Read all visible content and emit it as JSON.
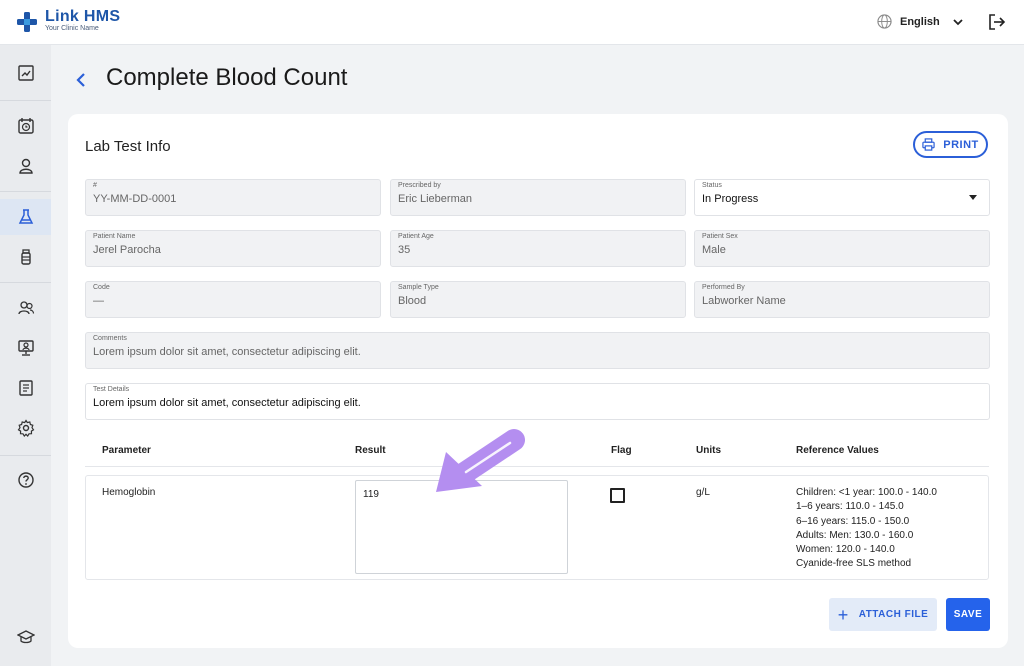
{
  "app": {
    "name": "Link HMS",
    "subtitle": "Your Clinic Name"
  },
  "header": {
    "language": "English"
  },
  "page": {
    "title": "Complete Blood Count"
  },
  "card": {
    "title": "Lab Test Info",
    "print_label": "PRINT"
  },
  "fields": {
    "id": {
      "label": "#",
      "value": "YY-MM-DD-0001"
    },
    "prescribed_by": {
      "label": "Prescribed by",
      "value": "Eric Lieberman"
    },
    "status": {
      "label": "Status",
      "value": "In Progress"
    },
    "patient_name": {
      "label": "Patient Name",
      "value": "Jerel Parocha"
    },
    "patient_age": {
      "label": "Patient Age",
      "value": "35"
    },
    "patient_sex": {
      "label": "Patient Sex",
      "value": "Male"
    },
    "code": {
      "label": "Code",
      "value": "—"
    },
    "sample_type": {
      "label": "Sample Type",
      "value": "Blood"
    },
    "performed_by": {
      "label": "Performed By",
      "value": "Labworker Name"
    },
    "comments": {
      "label": "Comments",
      "value": "Lorem ipsum dolor sit amet, consectetur adipiscing elit."
    },
    "test_details": {
      "label": "Test Details",
      "value": "Lorem ipsum dolor sit amet, consectetur adipiscing elit."
    }
  },
  "table": {
    "headers": {
      "parameter": "Parameter",
      "result": "Result",
      "flag": "Flag",
      "units": "Units",
      "reference": "Reference Values"
    },
    "rows": [
      {
        "parameter": "Hemoglobin",
        "result": "119",
        "units": "g/L",
        "reference": [
          "Children: <1 year: 100.0 - 140.0",
          "1–6 years: 110.0 - 145.0",
          "6–16 years: 115.0 - 150.0",
          "Adults: Men: 130.0 - 160.0",
          "Women: 120.0 - 140.0",
          "Cyanide-free SLS method"
        ]
      }
    ]
  },
  "actions": {
    "attach_label": "ATTACH FILE",
    "save_label": "SAVE"
  },
  "colors": {
    "accent": "#2563eb",
    "brand": "#1e56a8",
    "annotation_arrow": "#b48ef0"
  }
}
